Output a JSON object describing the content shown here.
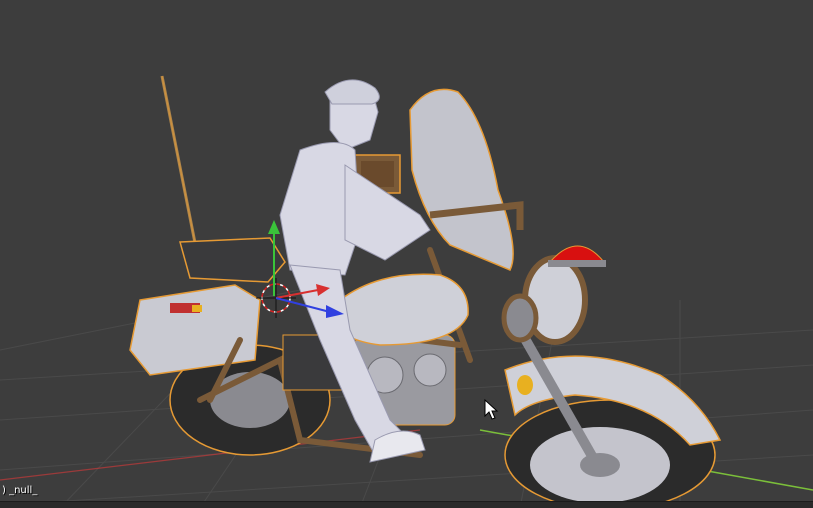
{
  "viewport": {
    "object_name": "_null_",
    "object_index": ")",
    "colors": {
      "background": "#3d3d3d",
      "grid": "#4a4a4a",
      "axis_x": "#c43a3a",
      "axis_y": "#7bbf3a",
      "selection_outline": "#e69a34",
      "model_body": "#cfd0d8",
      "model_frame": "#7a5a38",
      "rider": "#d8d8e4",
      "siren": "#d81010"
    },
    "manipulator": {
      "x_icon": "manipulator-x-arrow-icon",
      "y_icon": "manipulator-y-arrow-icon",
      "z_icon": "manipulator-z-arrow-icon",
      "cursor_icon": "3d-cursor-icon"
    }
  }
}
